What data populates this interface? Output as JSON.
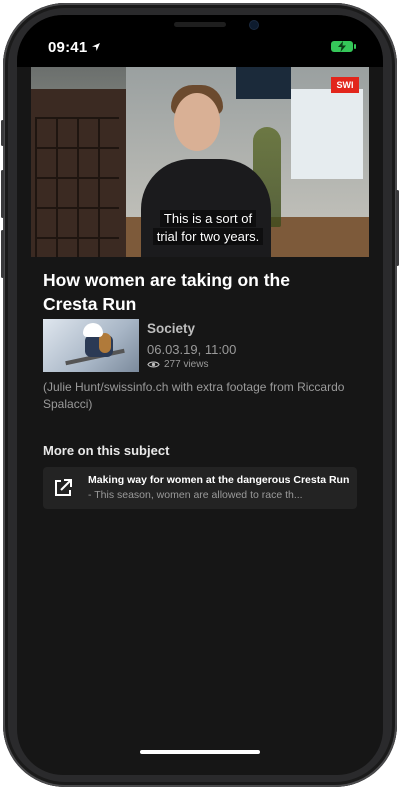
{
  "status": {
    "time": "09:41"
  },
  "video": {
    "caption_line1": "This is a sort of",
    "caption_line2": "trial for two years.",
    "channel_badge": "SWI"
  },
  "article": {
    "title": "How women are taking on the Cresta Run",
    "category": "Society",
    "date": "06.03.19, 11:00",
    "views": "277 views",
    "credit": "(Julie Hunt/swissinfo.ch with extra footage from Riccardo Spalacci)"
  },
  "more": {
    "heading": "More on this subject",
    "items": [
      {
        "title": "Making way for women at the dangerous Cresta Run",
        "separator": " - ",
        "snippet": "This season, women are allowed to race th..."
      }
    ]
  },
  "colors": {
    "background": "#161616",
    "card": "#232323",
    "battery": "#35c759",
    "badge": "#e2261c"
  },
  "icons": [
    "location-arrow-icon",
    "battery-icon",
    "eye-icon",
    "external-link-icon"
  ]
}
